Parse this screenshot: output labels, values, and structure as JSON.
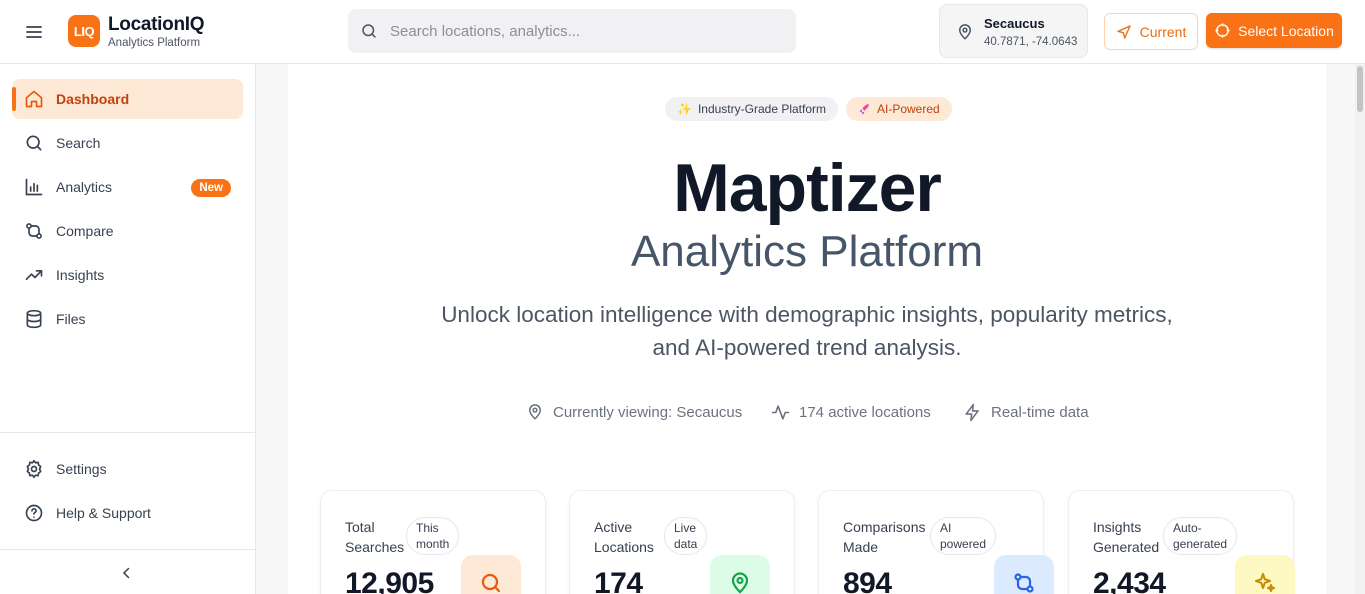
{
  "header": {
    "logo_text": "LIQ",
    "brand_name": "LocationIQ",
    "brand_sub": "Analytics Platform",
    "search_placeholder": "Search locations, analytics...",
    "location_name": "Secaucus",
    "location_coords": "40.7871, -74.0643",
    "current_label": "Current",
    "select_location_label": "Select Location",
    "accent": "#f97316"
  },
  "sidebar": {
    "items": [
      {
        "label": "Dashboard",
        "icon": "home-icon",
        "active": true
      },
      {
        "label": "Search",
        "icon": "search-icon"
      },
      {
        "label": "Analytics",
        "icon": "bar-chart-icon",
        "badge": "New"
      },
      {
        "label": "Compare",
        "icon": "git-compare-icon"
      },
      {
        "label": "Insights",
        "icon": "trending-up-icon"
      },
      {
        "label": "Files",
        "icon": "database-icon"
      }
    ],
    "bottom_items": [
      {
        "label": "Settings",
        "icon": "gear-icon"
      },
      {
        "label": "Help & Support",
        "icon": "help-circle-icon"
      }
    ]
  },
  "hero": {
    "pill_1": "Industry-Grade Platform",
    "pill_2": "AI-Powered",
    "title": "Maptizer",
    "subtitle": "Analytics Platform",
    "description_line1": "Unlock location intelligence with demographic insights, popularity metrics,",
    "description_line2": "and AI-powered trend analysis.",
    "meta_1": "Currently viewing: Secaucus",
    "meta_2": "174 active locations",
    "meta_3": "Real-time data"
  },
  "stats": [
    {
      "label_1": "Total",
      "label_2": "Searches",
      "chip_1": "This",
      "chip_2": "month",
      "value": "12,905",
      "icon": "search-icon",
      "icon_bg": "#fde9d5",
      "icon_color": "#ea580c"
    },
    {
      "label_1": "Active",
      "label_2": "Locations",
      "chip_1": "Live",
      "chip_2": "data",
      "value": "174",
      "icon": "map-pin-icon",
      "icon_bg": "#dcfce7",
      "icon_color": "#16a34a"
    },
    {
      "label_1": "Comparisons",
      "label_2": "Made",
      "chip_1": "AI",
      "chip_2": "powered",
      "value": "894",
      "icon": "git-compare-icon",
      "icon_bg": "#dbeafe",
      "icon_color": "#2563eb"
    },
    {
      "label_1": "Insights",
      "label_2": "Generated",
      "chip_1": "Auto-",
      "chip_2": "generated",
      "value": "2,434",
      "icon": "sparkles-icon",
      "icon_bg": "#fef9c3",
      "icon_color": "#ca8a04"
    }
  ]
}
